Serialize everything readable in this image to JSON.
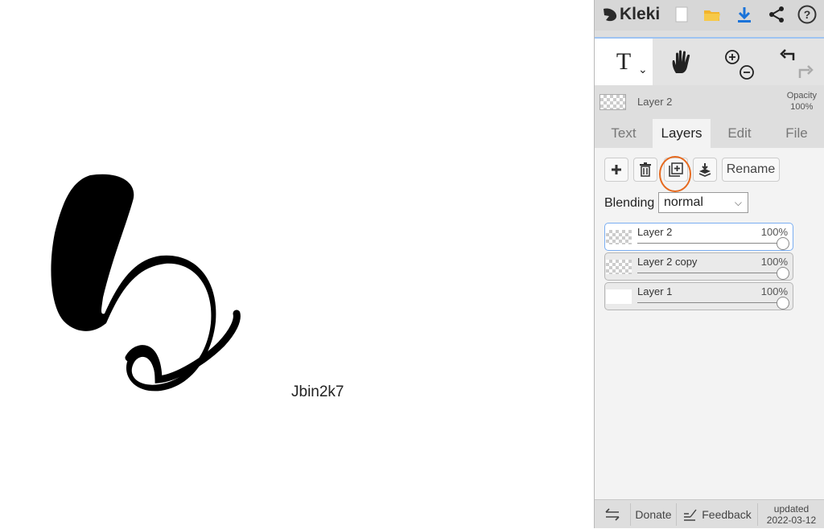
{
  "canvas": {
    "text": "Jbin2k7"
  },
  "app": {
    "name": "Kleki"
  },
  "toolbar": {
    "icons": [
      "new-file-icon",
      "open-folder-icon",
      "download-icon",
      "share-icon",
      "help-icon"
    ]
  },
  "tools": {
    "text_tool_glyph": "T",
    "chevron": "⌄"
  },
  "active_layer": {
    "name": "Layer 2",
    "opacity_label": "Opacity",
    "opacity_value": "100%"
  },
  "tabs": [
    {
      "label": "Text"
    },
    {
      "label": "Layers"
    },
    {
      "label": "Edit"
    },
    {
      "label": "File"
    }
  ],
  "layers_panel": {
    "rename_label": "Rename",
    "blending_label": "Blending",
    "blending_value": "normal",
    "layers": [
      {
        "name": "Layer 2",
        "opacity": "100%"
      },
      {
        "name": "Layer 2 copy",
        "opacity": "100%"
      },
      {
        "name": "Layer 1",
        "opacity": "100%"
      }
    ]
  },
  "footer": {
    "donate": "Donate",
    "feedback": "Feedback",
    "updated_label": "updated",
    "updated_date": "2022-03-12"
  },
  "colors": {
    "accent_blue": "#1a73d9",
    "highlight_orange": "#e66a1f",
    "folder_yellow": "#f2b42c"
  }
}
